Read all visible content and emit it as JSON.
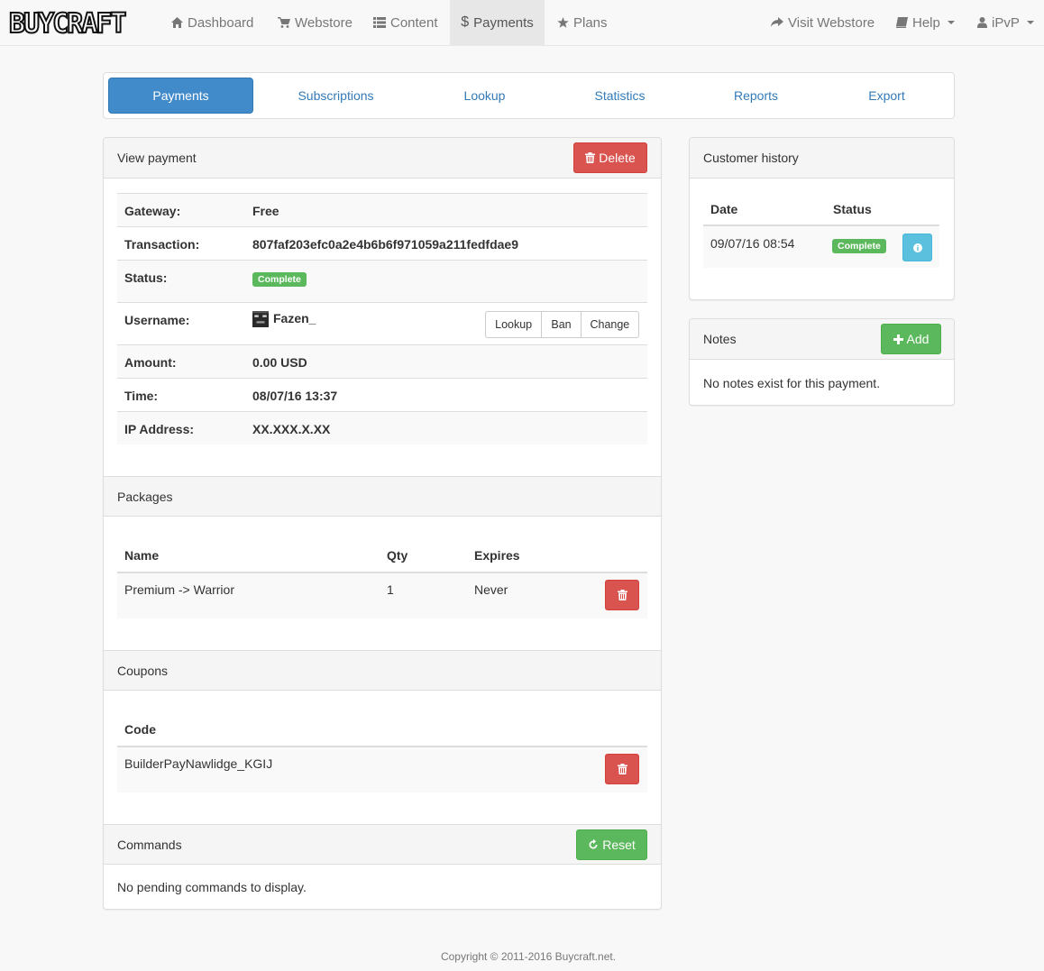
{
  "brand": {
    "logo_text": "BUYCRAFT"
  },
  "navbar": {
    "items": [
      {
        "label": "Dashboard",
        "icon": "home-icon"
      },
      {
        "label": "Webstore",
        "icon": "cart-icon"
      },
      {
        "label": "Content",
        "icon": "list-icon"
      },
      {
        "label": "Payments",
        "icon": "dollar-icon",
        "active": true
      },
      {
        "label": "Plans",
        "icon": "star-icon"
      }
    ],
    "right": [
      {
        "label": "Visit Webstore",
        "icon": "share-icon"
      },
      {
        "label": "Help",
        "icon": "book-icon",
        "dropdown": true
      },
      {
        "label": "iPvP",
        "icon": "user-icon",
        "dropdown": true
      }
    ]
  },
  "subnav": {
    "items": [
      "Payments",
      "Subscriptions",
      "Lookup",
      "Statistics",
      "Reports",
      "Export"
    ],
    "active": "Payments"
  },
  "view_payment": {
    "title": "View payment",
    "delete_label": "Delete",
    "rows": {
      "gateway": {
        "label": "Gateway:",
        "value": "Free"
      },
      "transaction": {
        "label": "Transaction:",
        "value": "807faf203efc0a2e4b6b6f971059a211fedfdae9"
      },
      "status": {
        "label": "Status:",
        "value": "Complete"
      },
      "username": {
        "label": "Username:",
        "value": "Fazen_"
      },
      "amount": {
        "label": "Amount:",
        "value": "0.00 USD"
      },
      "time": {
        "label": "Time:",
        "value": "08/07/16 13:37"
      },
      "ip": {
        "label": "IP Address:",
        "value": "XX.XXX.X.XX"
      }
    },
    "user_actions": {
      "lookup": "Lookup",
      "ban": "Ban",
      "change": "Change"
    }
  },
  "packages": {
    "title": "Packages",
    "headers": {
      "name": "Name",
      "qty": "Qty",
      "expires": "Expires"
    },
    "rows": [
      {
        "name": "Premium -> Warrior",
        "qty": "1",
        "expires": "Never"
      }
    ]
  },
  "coupons": {
    "title": "Coupons",
    "headers": {
      "code": "Code"
    },
    "rows": [
      {
        "code": "BuilderPayNawlidge_KGIJ"
      }
    ]
  },
  "commands": {
    "title": "Commands",
    "reset_label": "Reset",
    "empty_text": "No pending commands to display."
  },
  "customer_history": {
    "title": "Customer history",
    "headers": {
      "date": "Date",
      "status": "Status"
    },
    "rows": [
      {
        "date": "09/07/16 08:54",
        "status": "Complete"
      }
    ]
  },
  "notes": {
    "title": "Notes",
    "add_label": "Add",
    "empty_text": "No notes exist for this payment."
  },
  "footer": {
    "text": "Copyright © 2011-2016 Buycraft.net."
  },
  "colors": {
    "primary": "#428bca",
    "link": "#337ab7",
    "danger": "#d9534f",
    "success": "#5cb85c",
    "info": "#5bc0de"
  }
}
